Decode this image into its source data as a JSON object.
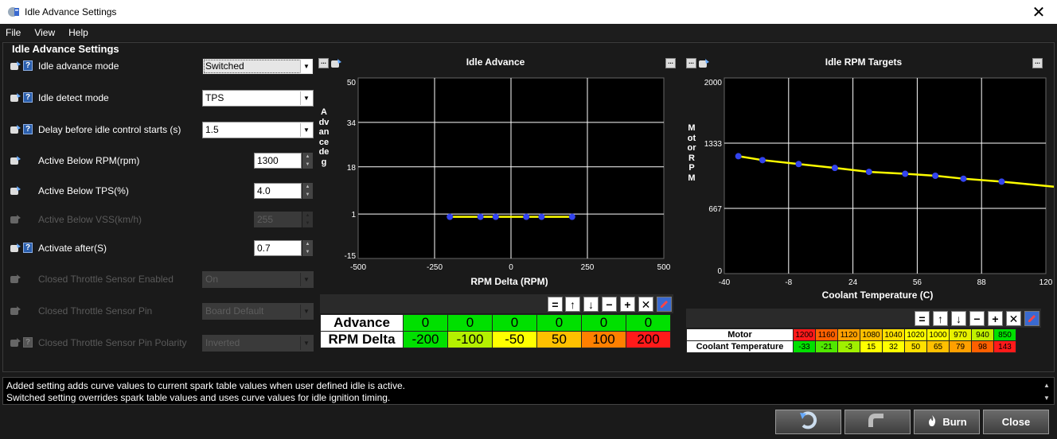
{
  "window": {
    "title": "Idle Advance Settings",
    "close_glyph": "✕"
  },
  "menu": [
    "File",
    "View",
    "Help"
  ],
  "panel": {
    "title": "Idle Advance Settings"
  },
  "settings": [
    {
      "label": "Idle advance mode",
      "value": "Switched"
    },
    {
      "label": "Idle detect mode",
      "value": "TPS"
    },
    {
      "label": "Delay before idle control starts (s)",
      "value": "1.5"
    },
    {
      "label": "Active Below RPM(rpm)",
      "value": "1300"
    },
    {
      "label": "Active Below TPS(%)",
      "value": "4.0"
    },
    {
      "label": "Active Below VSS(km/h)",
      "value": "255"
    },
    {
      "label": "Activate after(S)",
      "value": "0.7"
    },
    {
      "label": "Closed Throttle Sensor Enabled",
      "value": "On"
    },
    {
      "label": "Closed Throttle Sensor Pin",
      "value": "Board Default"
    },
    {
      "label": "Closed Throttle Sensor Pin Polarity",
      "value": "Inverted"
    }
  ],
  "help_glyph": "?",
  "chart_data": [
    {
      "type": "line",
      "title": "Idle Advance",
      "xlabel": "RPM Delta (RPM)",
      "ylabel": "Advance deg",
      "xlim": [
        -500,
        500
      ],
      "ylim": [
        -15,
        50
      ],
      "x_ticks": [
        "-500",
        "-250",
        "0",
        "250",
        "500"
      ],
      "y_ticks": [
        "50",
        "34",
        "18",
        "1",
        "-15"
      ],
      "y_tick_values": [
        50,
        34,
        18,
        1,
        -15
      ],
      "x": [
        -200,
        -100,
        -50,
        50,
        100,
        200
      ],
      "y": [
        0,
        0,
        0,
        0,
        0,
        0
      ],
      "grid": true
    },
    {
      "type": "line",
      "title": "Idle RPM Targets",
      "xlabel": "Coolant Temperature (C)",
      "ylabel": "Motor RPM",
      "xlim": [
        -40,
        120
      ],
      "ylim": [
        0,
        2000
      ],
      "x_ticks": [
        "-40",
        "-8",
        "24",
        "56",
        "88",
        "120"
      ],
      "y_ticks": [
        "2000",
        "1333",
        "667",
        "0"
      ],
      "y_tick_values": [
        2000,
        1333,
        667,
        0
      ],
      "x": [
        -33,
        -21,
        -3,
        15,
        32,
        50,
        65,
        79,
        98,
        143
      ],
      "y": [
        1200,
        1160,
        1120,
        1080,
        1040,
        1020,
        1000,
        970,
        940,
        850
      ],
      "grid": true
    }
  ],
  "table1": {
    "row_labels": [
      "Advance",
      "RPM Delta"
    ],
    "advance": [
      "0",
      "0",
      "0",
      "0",
      "0",
      "0"
    ],
    "rpm_delta": [
      "-200",
      "-100",
      "-50",
      "50",
      "100",
      "200"
    ],
    "advance_color": "#00e000",
    "delta_colors": [
      "#00e000",
      "#b4f000",
      "#ffff00",
      "#ffc000",
      "#ff8000",
      "#ff1a1a"
    ]
  },
  "table2": {
    "row_labels": [
      "Motor",
      "Coolant Temperature"
    ],
    "motor": [
      "1200",
      "1160",
      "1120",
      "1080",
      "1040",
      "1020",
      "1000",
      "970",
      "940",
      "850"
    ],
    "coolant": [
      "-33",
      "-21",
      "-3",
      "15",
      "32",
      "50",
      "65",
      "79",
      "98",
      "143"
    ],
    "motor_colors": [
      "#ff1a1a",
      "#ff6000",
      "#ffa000",
      "#ffc000",
      "#ffe000",
      "#ffff00",
      "#ffff00",
      "#e8f000",
      "#c0f000",
      "#00e000"
    ],
    "coolant_colors": [
      "#00e000",
      "#50e800",
      "#a0f000",
      "#ffff00",
      "#ffff00",
      "#ffe000",
      "#ffc000",
      "#ffa000",
      "#ff6000",
      "#ff1a1a"
    ]
  },
  "toolbar_glyphs": [
    "=",
    "↑",
    "↓",
    "−",
    "+",
    "✕"
  ],
  "status": {
    "line1": "Added setting adds curve values to current spark table values when user defined idle is active.",
    "line2": " Switched setting overrides spark table values and uses curve values for idle ignition timing."
  },
  "buttons": {
    "burn": "Burn",
    "close": "Close"
  },
  "icons": [
    "app-icon",
    "chart-curve-icon",
    "help-icon",
    "undo-icon",
    "pipe-icon",
    "flame-icon",
    "pencil-icon",
    "ellipsis-icon"
  ],
  "colors": {
    "line": "#ffff00",
    "point": "#3344ee",
    "grid": "#ffffff",
    "plot_bg": "#000000"
  }
}
